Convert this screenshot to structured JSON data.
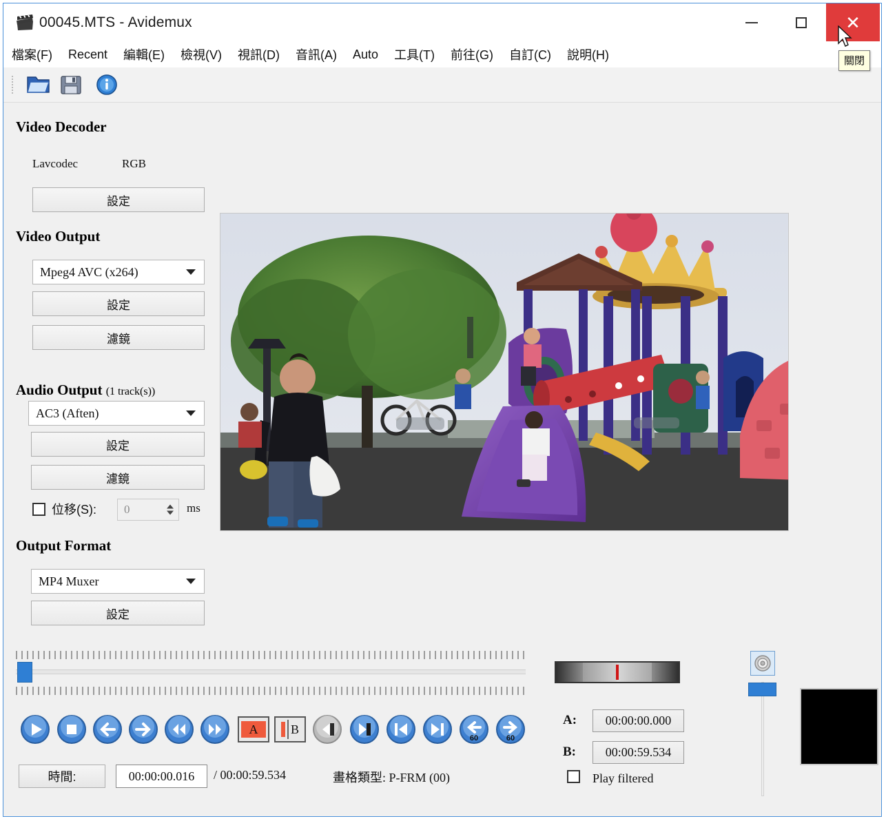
{
  "window": {
    "title": "00045.MTS - Avidemux",
    "title_icon": "clapperboard-icon",
    "minimize_label": "—",
    "maximize_label": "□",
    "close_label": "✕",
    "close_tooltip": "關閉"
  },
  "menubar": {
    "items": [
      {
        "text": "檔案(F)",
        "mnemonic": "F"
      },
      {
        "text": "Recent",
        "mnemonic": "R"
      },
      {
        "text": "編輯(E)",
        "mnemonic": "E"
      },
      {
        "text": "檢視(V)",
        "mnemonic": "V"
      },
      {
        "text": "視訊(D)",
        "mnemonic": "D"
      },
      {
        "text": "音訊(A)",
        "mnemonic": "A"
      },
      {
        "text": "Auto",
        "mnemonic": "A"
      },
      {
        "text": "工具(T)",
        "mnemonic": "T"
      },
      {
        "text": "前往(G)",
        "mnemonic": "G"
      },
      {
        "text": "自訂(C)",
        "mnemonic": "C"
      },
      {
        "text": "說明(H)",
        "mnemonic": "H"
      }
    ]
  },
  "toolbar": {
    "buttons": [
      {
        "name": "open-file-icon"
      },
      {
        "name": "save-file-icon"
      },
      {
        "name": "info-icon"
      }
    ]
  },
  "video_decoder": {
    "heading": "Video Decoder",
    "codec": "Lavcodec",
    "colorspace": "RGB",
    "configure_label": "設定"
  },
  "video_output": {
    "heading": "Video Output",
    "selected": "Mpeg4 AVC (x264)",
    "configure_label": "設定",
    "filters_label": "濾鏡"
  },
  "audio_output": {
    "heading": "Audio Output",
    "track_count": "(1 track(s))",
    "selected": "AC3 (Aften)",
    "configure_label": "設定",
    "filters_label": "濾鏡",
    "shift_label": "位移(S):",
    "shift_value": "0",
    "shift_unit": "ms",
    "shift_checked": false
  },
  "output_format": {
    "heading": "Output Format",
    "selected": "MP4 Muxer",
    "configure_label": "設定"
  },
  "transport": {
    "buttons": [
      {
        "name": "play-button"
      },
      {
        "name": "stop-button"
      },
      {
        "name": "step-back-button"
      },
      {
        "name": "step-forward-button"
      },
      {
        "name": "rewind-button"
      },
      {
        "name": "fast-forward-button"
      },
      {
        "name": "mark-a-button",
        "label": "A"
      },
      {
        "name": "mark-b-button",
        "label": "B"
      },
      {
        "name": "previous-black-frame-button"
      },
      {
        "name": "next-black-frame-button"
      },
      {
        "name": "previous-keyframe-button"
      },
      {
        "name": "next-keyframe-button"
      },
      {
        "name": "back-60-button",
        "label": "60"
      },
      {
        "name": "forward-60-button",
        "label": "60"
      }
    ]
  },
  "statusbar": {
    "time_button_label": "時間:",
    "current_time": "00:00:00.016",
    "total_time": "/ 00:00:59.534",
    "frame_type_label": "畫格類型:",
    "frame_type_value": "P-FRM (00)"
  },
  "markers": {
    "a_label": "A:",
    "a_value": "00:00:00.000",
    "b_label": "B:",
    "b_value": "00:00:59.534",
    "play_filtered_label": "Play filtered",
    "play_filtered_checked": false
  },
  "volume": {
    "speaker_icon": "speaker-icon",
    "slider_value": 100
  },
  "colors": {
    "accent_blue": "#2f7fd4",
    "close_red": "#e03b3b",
    "marker_red": "#d01616",
    "window_border": "#4a90d9",
    "panel_bg": "#f0f0f0"
  },
  "preview": {
    "scene_description": "playground with children on slides and a man walking"
  }
}
